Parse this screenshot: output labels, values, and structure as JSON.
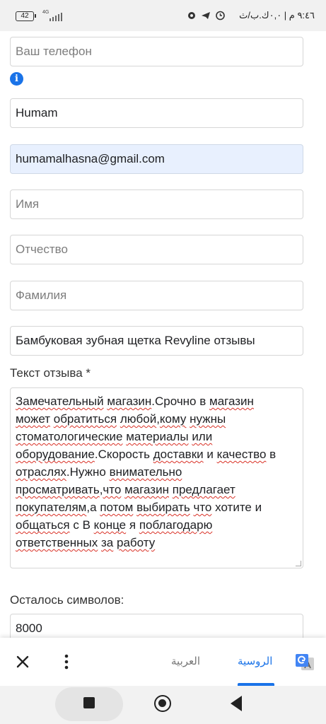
{
  "status_bar": {
    "battery": "42",
    "network": "4G",
    "time": "٩:٤٦ م | ٠,٠ك.ب/ث"
  },
  "form": {
    "phone_placeholder": "Ваш телефон",
    "info_icon": "i",
    "name_value": "Humam",
    "email_value": "humamalhasna@gmail.com",
    "first_name_placeholder": "Имя",
    "middle_name_placeholder": "Отчество",
    "last_name_placeholder": "Фамилия",
    "subject_value": "Бамбуковая зубная щетка Revyline отзывы",
    "review_label": "Текст отзыва *",
    "review_lines": [
      "  Замечательный магазин.Срочно в магазин",
      "может обратиться любой,кому нужны",
      "стоматологические материалы или",
      "оборудование.Скорость доставки и качество в",
      "отраслях.Нужно внимательно",
      "просматривать,что магазин предлагает",
      "покупателям,а потом выбирать что хотите и",
      "общаться с В конце я поблагодарю",
      "ответственных за работу"
    ],
    "remaining_label": "Осталось символов:",
    "remaining_value": "8000"
  },
  "translate_bar": {
    "target_language": "العربية",
    "source_language": "الروسية",
    "close_icon": "close-icon",
    "more_icon": "more-vert-icon",
    "logo_icon": "google-translate-icon",
    "accent": "#1a73e8"
  },
  "nav_bar": {
    "recents_icon": "square-icon",
    "home_icon": "home-circle-icon",
    "back_icon": "back-triangle-icon"
  }
}
